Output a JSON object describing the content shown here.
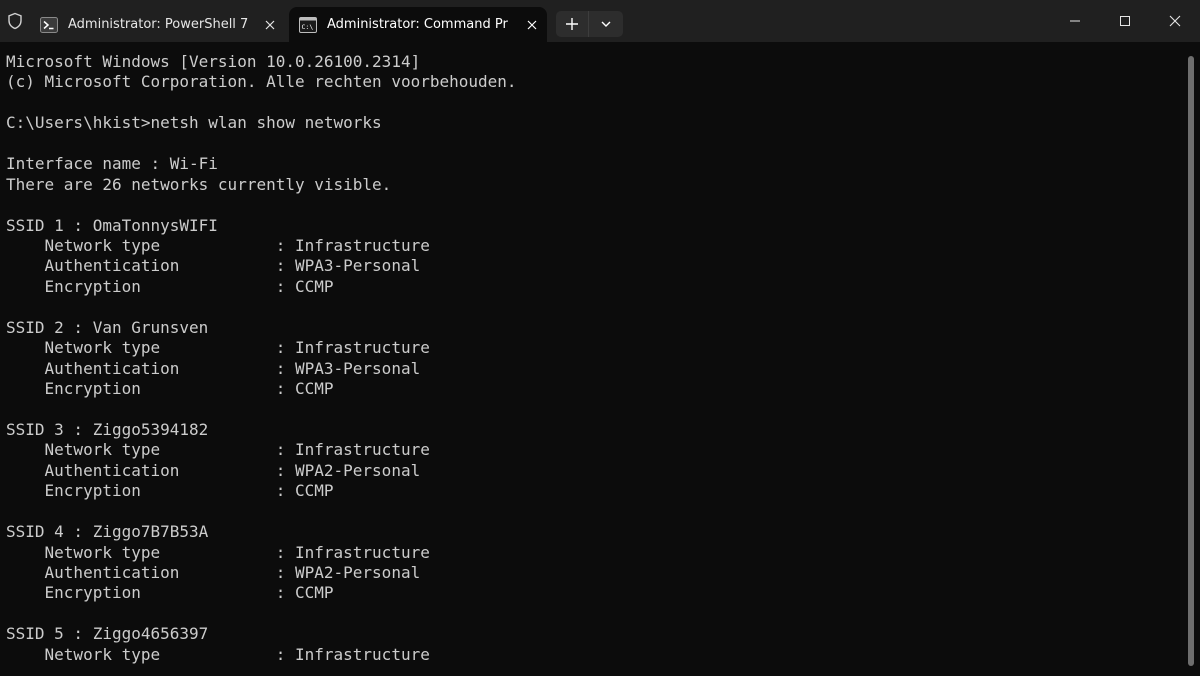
{
  "window": {
    "tabs": [
      {
        "title": "Administrator: PowerShell 7",
        "icon": "powershell-icon",
        "active": false
      },
      {
        "title": "Administrator: Command Pr",
        "icon": "command-prompt-icon",
        "active": true
      }
    ],
    "controls": [
      "minimize-icon",
      "maximize-icon",
      "close-icon"
    ],
    "colors": {
      "titlebar": "#202020",
      "terminal_bg": "#0c0c0c",
      "text": "#cccccc"
    }
  },
  "terminal": {
    "lines": [
      "Microsoft Windows [Version 10.0.26100.2314]",
      "(c) Microsoft Corporation. Alle rechten voorbehouden.",
      "",
      "C:\\Users\\hkist>netsh wlan show networks",
      "",
      "Interface name : Wi-Fi",
      "There are 26 networks currently visible.",
      "",
      "SSID 1 : OmaTonnysWIFI",
      "    Network type            : Infrastructure",
      "    Authentication          : WPA3-Personal",
      "    Encryption              : CCMP",
      "",
      "SSID 2 : Van Grunsven",
      "    Network type            : Infrastructure",
      "    Authentication          : WPA3-Personal",
      "    Encryption              : CCMP",
      "",
      "SSID 3 : Ziggo5394182",
      "    Network type            : Infrastructure",
      "    Authentication          : WPA2-Personal",
      "    Encryption              : CCMP",
      "",
      "SSID 4 : Ziggo7B7B53A",
      "    Network type            : Infrastructure",
      "    Authentication          : WPA2-Personal",
      "    Encryption              : CCMP",
      "",
      "SSID 5 : Ziggo4656397",
      "    Network type            : Infrastructure"
    ]
  }
}
